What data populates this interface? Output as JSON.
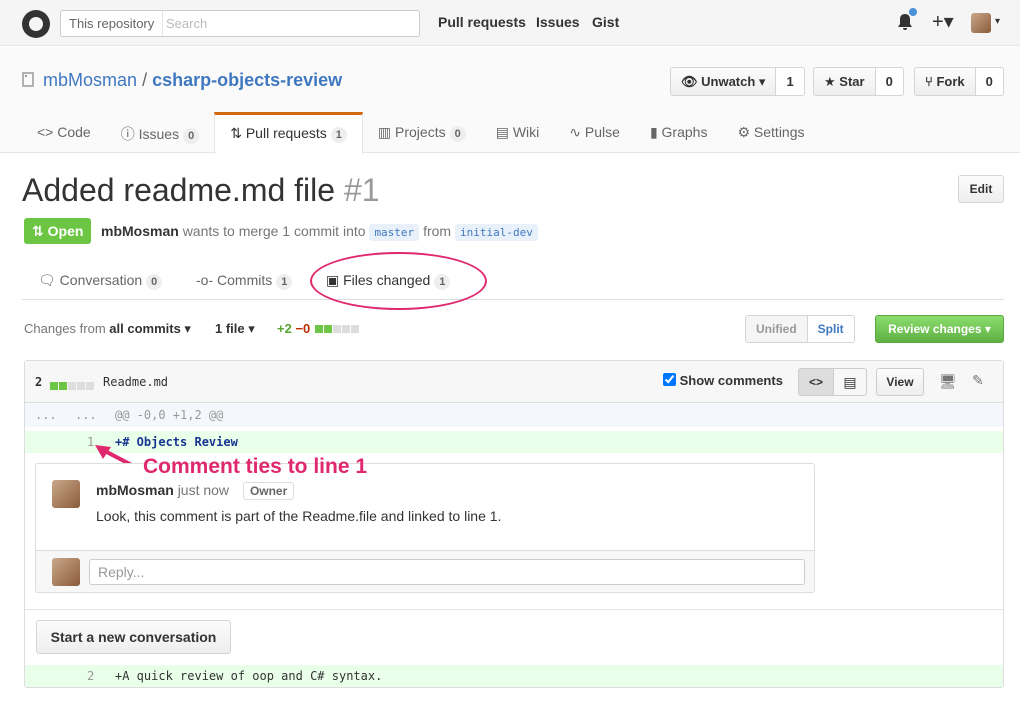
{
  "header": {
    "scope_label": "This repository",
    "search_placeholder": "Search",
    "nav": [
      "Pull requests",
      "Issues",
      "Gist"
    ],
    "plus_icon": "+▾"
  },
  "repo": {
    "owner": "mbMosman",
    "separator": "/",
    "name": "csharp-objects-review",
    "unwatch_label": "Unwatch ▾",
    "unwatch_count": "1",
    "star_label": "Star",
    "star_count": "0",
    "fork_label": "Fork",
    "fork_count": "0",
    "tabs": [
      {
        "label": "Code",
        "count": ""
      },
      {
        "label": "Issues",
        "count": "0"
      },
      {
        "label": "Pull requests",
        "count": "1"
      },
      {
        "label": "Projects",
        "count": "0"
      },
      {
        "label": "Wiki",
        "count": ""
      },
      {
        "label": "Pulse",
        "count": ""
      },
      {
        "label": "Graphs",
        "count": ""
      },
      {
        "label": "Settings",
        "count": ""
      }
    ]
  },
  "pr": {
    "title": "Added readme.md file",
    "number": "#1",
    "edit_label": "Edit",
    "state": "Open",
    "author": "mbMosman",
    "merge_text": "wants to merge 1 commit into",
    "base": "master",
    "from_text": "from",
    "head": "initial-dev",
    "tabs": [
      {
        "label": "Conversation",
        "count": "0"
      },
      {
        "label": "Commits",
        "count": "1"
      },
      {
        "label": "Files changed",
        "count": "1"
      }
    ]
  },
  "toolbar": {
    "changes_from": "Changes from",
    "all_commits": "all commits ▾",
    "file_count": "1 file ▾",
    "additions": "+2",
    "deletions": "−0",
    "unified_label": "Unified",
    "split_label": "Split",
    "review_label": "Review changes ▾"
  },
  "file": {
    "change_count": "2",
    "name": "Readme.md",
    "show_comments_label": "Show comments",
    "view_label": "View",
    "hunk_left": "...",
    "hunk_right": "...",
    "hunk_header": "@@ -0,0 +1,2 @@",
    "lines": [
      {
        "num": "1",
        "code": "+# Objects Review"
      },
      {
        "num": "2",
        "code": "+A quick review of oop and C# syntax."
      }
    ],
    "comment": {
      "author": "mbMosman",
      "time": "just now",
      "badge": "Owner",
      "body": "Look, this comment is part of the Readme.file and linked to line 1."
    },
    "reply_placeholder": "Reply...",
    "start_conversation_label": "Start a new conversation"
  },
  "annotation": {
    "text": "Comment ties to line 1",
    "color": "#e0286e"
  },
  "colors": {
    "link": "#4078c0",
    "open_green": "#6cc644",
    "tab_accent": "#d26911"
  }
}
